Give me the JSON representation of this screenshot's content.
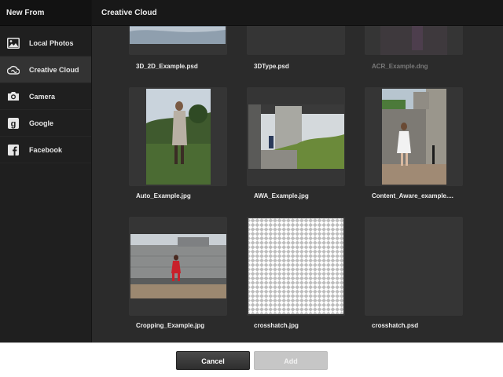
{
  "sidebar": {
    "title": "New From",
    "items": [
      {
        "label": "Local Photos",
        "icon": "photos-icon"
      },
      {
        "label": "Creative Cloud",
        "icon": "creative-cloud-icon",
        "active": true
      },
      {
        "label": "Camera",
        "icon": "camera-icon"
      },
      {
        "label": "Google",
        "icon": "google-icon"
      },
      {
        "label": "Facebook",
        "icon": "facebook-icon"
      }
    ]
  },
  "main": {
    "title": "Creative Cloud",
    "files": [
      {
        "name": "3D_2D_Example.psd",
        "available": true
      },
      {
        "name": "3DType.psd",
        "available": true
      },
      {
        "name": "ACR_Example.dng",
        "available": false
      },
      {
        "name": "Auto_Example.jpg",
        "available": true
      },
      {
        "name": "AWA_Example.jpg",
        "available": true
      },
      {
        "name": "Content_Aware_example....",
        "available": true
      },
      {
        "name": "Cropping_Example.jpg",
        "available": true
      },
      {
        "name": "crosshatch.jpg",
        "available": true
      },
      {
        "name": "crosshatch.psd",
        "available": true
      }
    ]
  },
  "footer": {
    "cancel_label": "Cancel",
    "add_label": "Add"
  }
}
